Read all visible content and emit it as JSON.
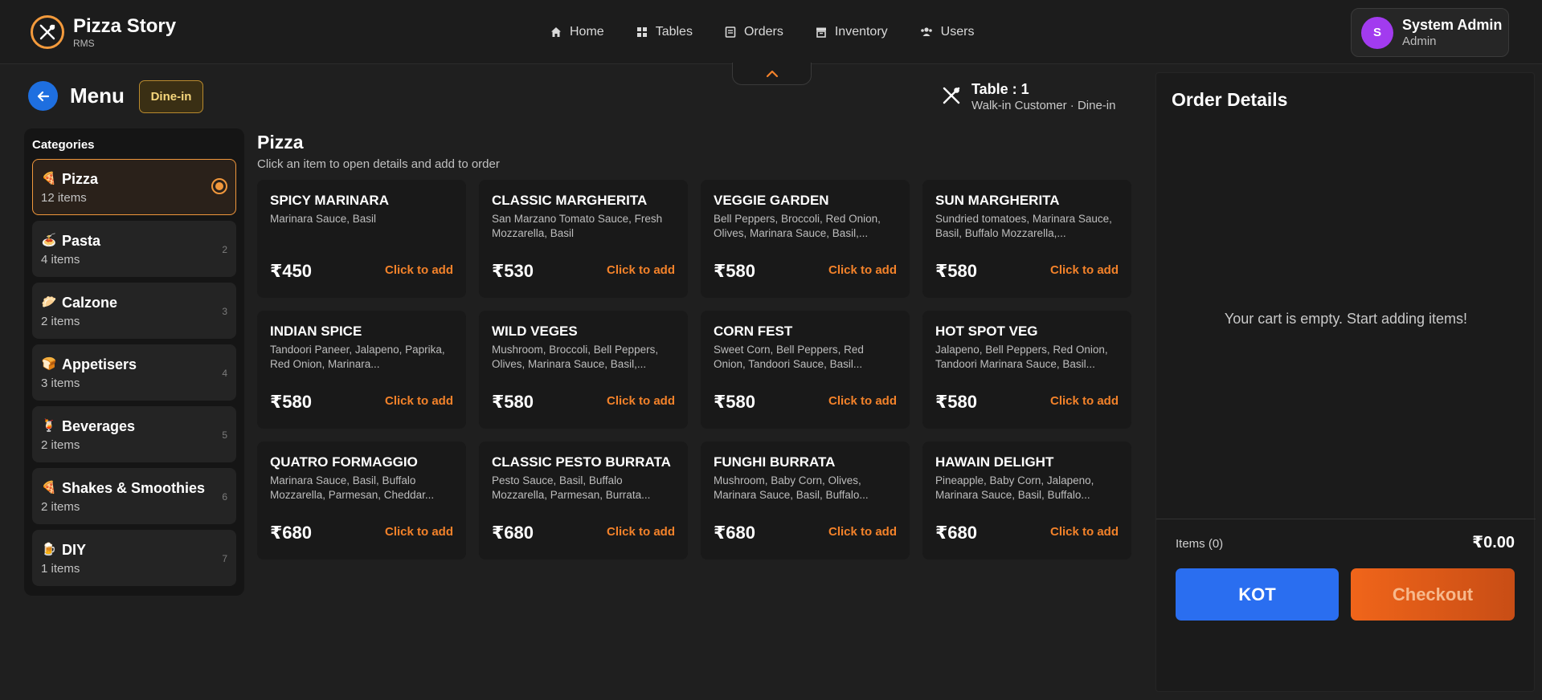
{
  "app": {
    "name": "Pizza Story",
    "subtitle": "RMS"
  },
  "nav": [
    {
      "label": "Home",
      "icon": "home-icon"
    },
    {
      "label": "Tables",
      "icon": "tables-icon"
    },
    {
      "label": "Orders",
      "icon": "orders-icon"
    },
    {
      "label": "Inventory",
      "icon": "inventory-icon"
    },
    {
      "label": "Users",
      "icon": "users-icon"
    }
  ],
  "user": {
    "initial": "S",
    "name": "System Admin",
    "role": "Admin"
  },
  "menu_header": {
    "title": "Menu",
    "mode_badge": "Dine-in"
  },
  "table": {
    "title": "Table : 1",
    "subtitle": "Walk-in Customer · Dine-in"
  },
  "categories": {
    "heading": "Categories",
    "items": [
      {
        "emoji": "🍕",
        "name": "Pizza",
        "count": "12 items",
        "index": ""
      },
      {
        "emoji": "🍝",
        "name": "Pasta",
        "count": "4 items",
        "index": "2"
      },
      {
        "emoji": "🥟",
        "name": "Calzone",
        "count": "2 items",
        "index": "3"
      },
      {
        "emoji": "🍞",
        "name": "Appetisers",
        "count": "3 items",
        "index": "4"
      },
      {
        "emoji": "🍹",
        "name": "Beverages",
        "count": "2 items",
        "index": "5"
      },
      {
        "emoji": "🍕",
        "name": "Shakes & Smoothies",
        "count": "2 items",
        "index": "6"
      },
      {
        "emoji": "🍺",
        "name": "DIY",
        "count": "1 items",
        "index": "7"
      }
    ],
    "active": "Pizza"
  },
  "section": {
    "title": "Pizza",
    "subtitle": "Click an item to open details and add to order"
  },
  "items": [
    {
      "name": "SPICY MARINARA",
      "desc": "Marinara Sauce, Basil",
      "price": "₹450",
      "action": "Click to add"
    },
    {
      "name": "CLASSIC MARGHERITA",
      "desc": "San Marzano Tomato Sauce, Fresh Mozzarella, Basil",
      "price": "₹530",
      "action": "Click to add"
    },
    {
      "name": "VEGGIE GARDEN",
      "desc": "Bell Peppers, Broccoli, Red Onion, Olives, Marinara Sauce, Basil,...",
      "price": "₹580",
      "action": "Click to add"
    },
    {
      "name": "SUN MARGHERITA",
      "desc": "Sundried tomatoes, Marinara Sauce, Basil, Buffalo Mozzarella,...",
      "price": "₹580",
      "action": "Click to add"
    },
    {
      "name": "INDIAN SPICE",
      "desc": "Tandoori Paneer, Jalapeno, Paprika, Red Onion, Marinara...",
      "price": "₹580",
      "action": "Click to add"
    },
    {
      "name": "WILD VEGES",
      "desc": "Mushroom, Broccoli, Bell Peppers, Olives, Marinara Sauce, Basil,...",
      "price": "₹580",
      "action": "Click to add"
    },
    {
      "name": "CORN FEST",
      "desc": "Sweet Corn, Bell Peppers, Red Onion, Tandoori Sauce, Basil...",
      "price": "₹580",
      "action": "Click to add"
    },
    {
      "name": "HOT SPOT VEG",
      "desc": "Jalapeno, Bell Peppers, Red Onion, Tandoori Marinara Sauce, Basil...",
      "price": "₹580",
      "action": "Click to add"
    },
    {
      "name": "QUATRO FORMAGGIO",
      "desc": "Marinara Sauce, Basil, Buffalo Mozzarella, Parmesan, Cheddar...",
      "price": "₹680",
      "action": "Click to add"
    },
    {
      "name": "CLASSIC PESTO BURRATA",
      "desc": "Pesto Sauce, Basil, Buffalo Mozzarella, Parmesan, Burrata...",
      "price": "₹680",
      "action": "Click to add"
    },
    {
      "name": "FUNGHI BURRATA",
      "desc": "Mushroom, Baby Corn, Olives, Marinara Sauce, Basil, Buffalo...",
      "price": "₹680",
      "action": "Click to add"
    },
    {
      "name": "HAWAIN DELIGHT",
      "desc": "Pineapple, Baby Corn, Jalapeno, Marinara Sauce, Basil, Buffalo...",
      "price": "₹680",
      "action": "Click to add"
    }
  ],
  "order": {
    "title": "Order Details",
    "empty_message": "Your cart is empty. Start adding items!",
    "items_label": "Items (0)",
    "total": "₹0.00",
    "kot_label": "KOT",
    "checkout_label": "Checkout"
  },
  "colors": {
    "accent_orange": "#f3822a",
    "primary_blue": "#2a6ef0",
    "avatar_purple": "#a23bef",
    "badge_gold": "#f6d77c"
  }
}
